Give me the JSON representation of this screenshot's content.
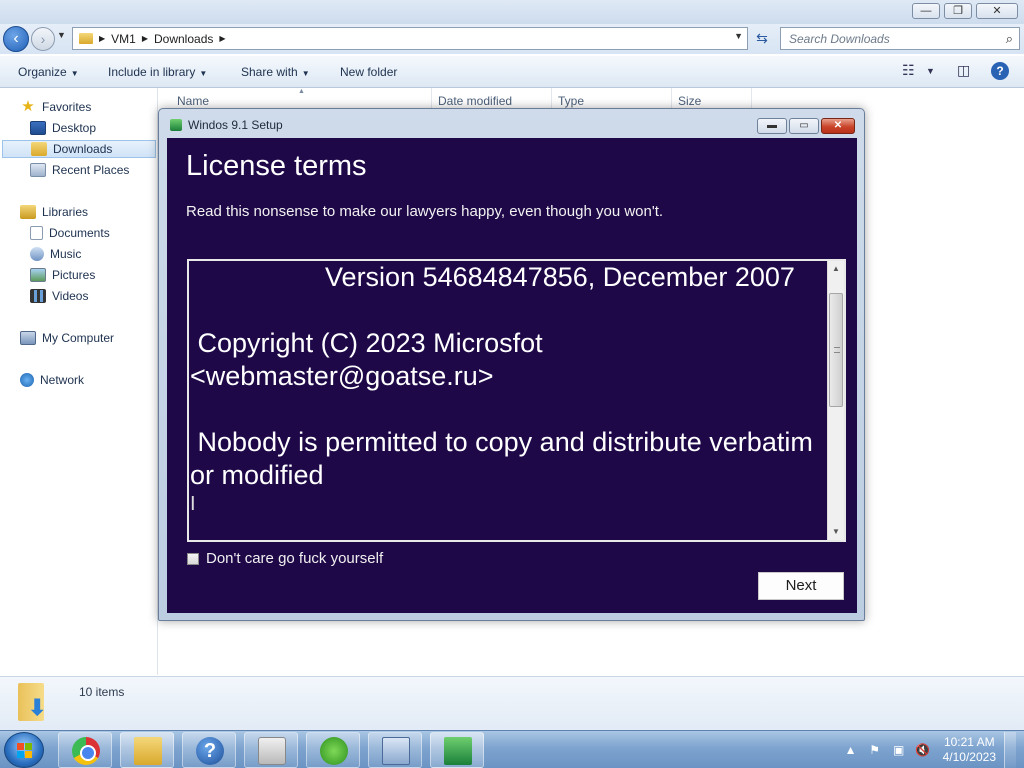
{
  "explorer": {
    "title_controls": {
      "minimize": "—",
      "maximize": "❐",
      "close": "✕"
    },
    "breadcrumb": [
      "VM1",
      "Downloads"
    ],
    "search_placeholder": "Search Downloads",
    "toolbar": {
      "organize": "Organize",
      "include_in_library": "Include in library",
      "share_with": "Share with",
      "new_folder": "New folder"
    },
    "sidebar": {
      "favorites": {
        "label": "Favorites",
        "items": [
          "Desktop",
          "Downloads",
          "Recent Places"
        ]
      },
      "libraries": {
        "label": "Libraries",
        "items": [
          "Documents",
          "Music",
          "Pictures",
          "Videos"
        ]
      },
      "computer": "My Computer",
      "network": "Network"
    },
    "columns": [
      "Name",
      "Date modified",
      "Type",
      "Size"
    ],
    "status": "10 items"
  },
  "dialog": {
    "title": "Windos 9.1 Setup",
    "heading": "License terms",
    "subheading": "Read this nonsense to make our lawyers happy, even though you won't.",
    "license_text": "                  Version 54684847856, December 2007\n\n Copyright (C) 2023 Microsfot <webmaster@goatse.ru>\n\n Nobody is permitted to copy and distribute verbatim or modified",
    "checkbox_label": "Don't care go fuck yourself",
    "checkbox_checked": false,
    "next_label": "Next"
  },
  "taskbar": {
    "time": "10:21 AM",
    "date": "4/10/2023"
  }
}
